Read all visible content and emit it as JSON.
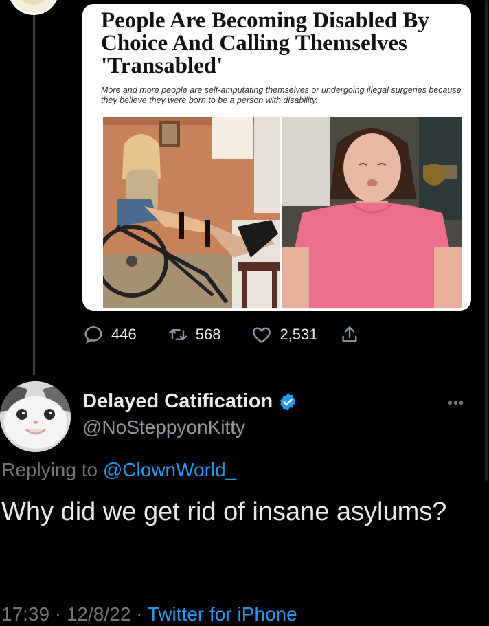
{
  "quoted_tweet": {
    "article": {
      "headline": "People Are Becoming Disabled By Choice And Calling Themselves 'Transabled'",
      "subheadline": "More and more people are self-amputating themselves or undergoing illegal surgeries because they believe they were born to be a person with disability."
    },
    "stats": {
      "replies": "446",
      "retweets": "568",
      "likes": "2,531"
    }
  },
  "reply_tweet": {
    "author": {
      "display_name": "Delayed Catification",
      "handle": "@NoSteppyonKitty",
      "verified": true
    },
    "replying_to_label": "Replying to",
    "replying_to_handle": "@ClownWorld_",
    "text": "Why did we get rid of insane asylums?",
    "time": "17:39",
    "date": "12/8/22",
    "separator": "·",
    "source": "Twitter for iPhone"
  },
  "icons": {
    "reply": "reply-icon",
    "retweet": "retweet-icon",
    "like": "heart-icon",
    "share": "share-icon",
    "verified": "verified-badge-icon",
    "more": "more-icon"
  },
  "colors": {
    "background": "#000000",
    "text": "#e7e9ea",
    "muted": "#71767b",
    "accent": "#1d9bf0"
  }
}
